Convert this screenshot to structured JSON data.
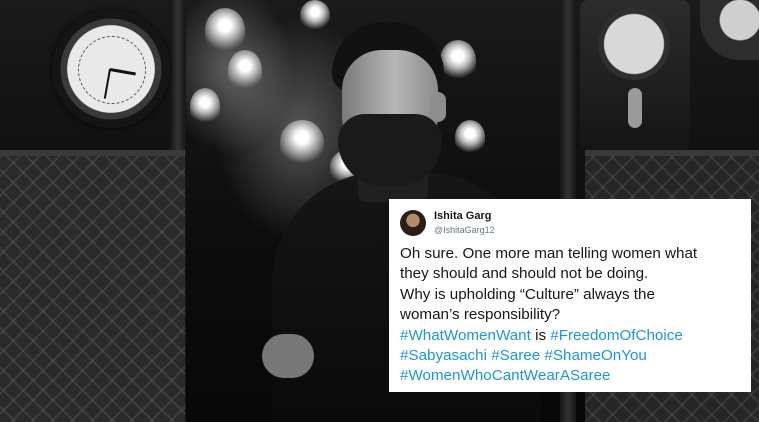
{
  "tweet": {
    "author_name": "Ishita Garg",
    "author_handle": "@IshitaGarg12",
    "text_line_1": "Oh sure. One more man telling women what",
    "text_line_2": "they should and should not be doing.",
    "text_line_3": "Why is upholding “Culture” always the",
    "text_line_4": "woman’s responsibility?",
    "hashtag_what_women_want": "#WhatWomenWant",
    "connector_is": " is ",
    "hashtag_freedom_of_choice": "#FreedomOfChoice",
    "hashtag_sabyasachi": "#Sabyasachi",
    "hashtag_saree": "#Saree",
    "hashtag_shame_on_you": "#ShameOnYou",
    "hashtag_women_who_cant": "#WomenWhoCantWearASaree"
  },
  "colors": {
    "hashtag": "#1b95e0",
    "text": "#14171a",
    "handle": "#657786",
    "card_background": "#ffffff"
  }
}
